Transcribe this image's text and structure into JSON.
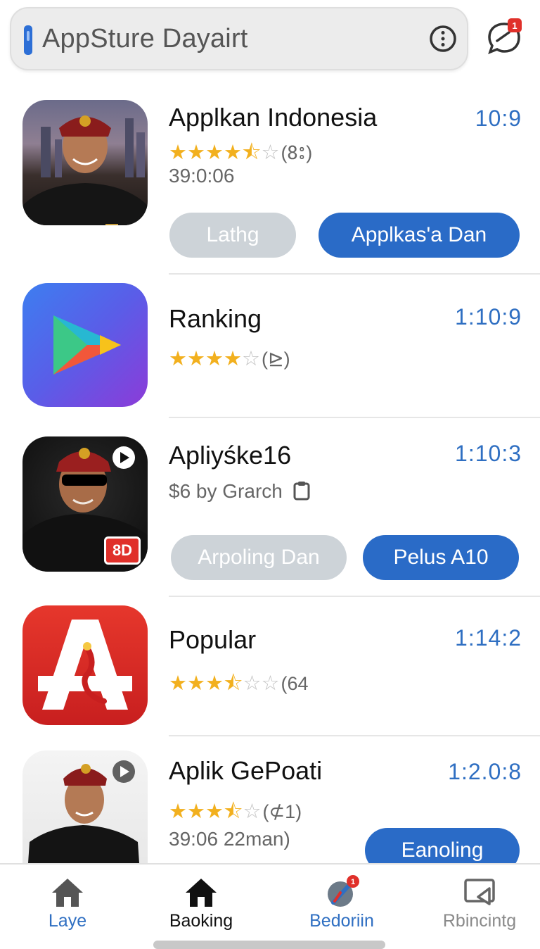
{
  "search": {
    "query": "AppSture Dayairt"
  },
  "notifications": {
    "badge": "1"
  },
  "apps": [
    {
      "title": "Applkan Indonesia",
      "time": "10:9",
      "rating_count": "(8ះ)",
      "subtitle": "39:0:06",
      "buttons": [
        "Lathg",
        "Applkas'a Dan"
      ]
    },
    {
      "title": "Ranking",
      "time": "1:10:9",
      "rating_count": "(⊵)"
    },
    {
      "title": "Apliyśke16",
      "time": "1:10:3",
      "subtitle": "$6 by Grarch",
      "badge": "8D",
      "buttons": [
        "Arpoling Dan",
        "Pelus A10"
      ]
    },
    {
      "title": "Popular",
      "time": "1:14:2",
      "rating_count": "(64"
    },
    {
      "title": "Aplik GePoati",
      "time": "1:2.0:8",
      "rating_count": "(⊄1)",
      "subtitle": "39:06 22man)",
      "buttons": [
        "Eanoling"
      ]
    }
  ],
  "nav": [
    {
      "label": "Laye",
      "icon": "home-icon",
      "color": "#2f6fc2"
    },
    {
      "label": "Baoking",
      "icon": "home-icon",
      "color": "#111111"
    },
    {
      "label": "Bedoriin",
      "icon": "rocket-icon",
      "color": "#2f6fc2",
      "badge": "1"
    },
    {
      "label": "Rbincintg",
      "icon": "cast-icon",
      "color": "#8a8a8a"
    }
  ],
  "colors": {
    "accent": "#2a6bc7",
    "star": "#f2b01e",
    "badge": "#e0302a"
  }
}
